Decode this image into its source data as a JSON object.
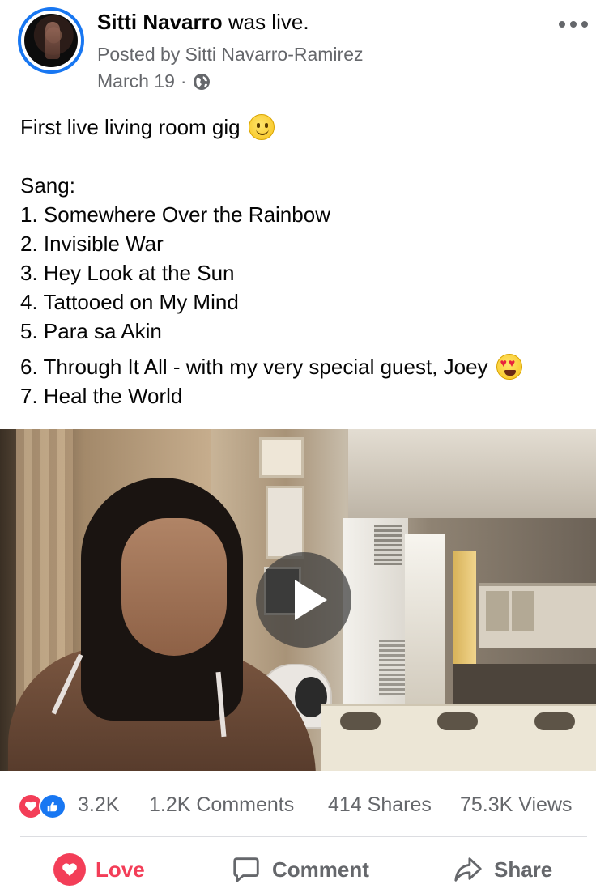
{
  "post": {
    "author": "Sitti Navarro",
    "action_text": "was live.",
    "posted_by": "Posted by Sitti Navarro-Ramirez",
    "date": "March 19",
    "date_separator": "·",
    "privacy_icon": "globe-icon",
    "more_icon": "more-options-icon"
  },
  "body": {
    "intro": "First live living room gig",
    "intro_emoji": "slightly-smiling-face",
    "sang_label": "Sang:",
    "songs": [
      "1. Somewhere Over the Rainbow",
      "2. Invisible War",
      "3. Hey Look at the Sun",
      "4. Tattooed on My Mind",
      "5. Para sa Akin",
      "6. Through It All - with my very special guest, Joey",
      "7. Heal the World"
    ],
    "song6_emoji": "heart-eyes"
  },
  "video": {
    "play_icon": "play-icon"
  },
  "stats": {
    "reactions": "3.2K",
    "comments": "1.2K Comments",
    "shares": "414 Shares",
    "views": "75.3K Views"
  },
  "actions": {
    "love_label": "Love",
    "comment_label": "Comment",
    "share_label": "Share"
  },
  "colors": {
    "accent_blue": "#1877f2",
    "love_red": "#f33e58",
    "secondary_text": "#65676b"
  }
}
